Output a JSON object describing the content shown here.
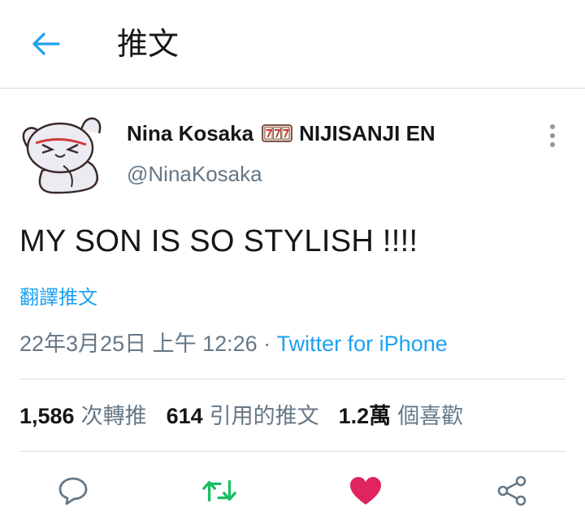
{
  "header": {
    "title": "推文"
  },
  "tweet": {
    "display_name": "Nina Kosaka",
    "display_name_suffix": "NIJISANJI EN",
    "handle": "@NinaKosaka",
    "text": "MY SON IS SO STYLISH !!!!",
    "translate_label": "翻譯推文",
    "timestamp": "22年3月25日 上午 12:26",
    "separator": " · ",
    "source": "Twitter for iPhone"
  },
  "stats": [
    {
      "count": "1,586",
      "label": "次轉推"
    },
    {
      "count": "614",
      "label": "引用的推文"
    },
    {
      "count": "1.2萬",
      "label": "個喜歡"
    }
  ],
  "colors": {
    "accent": "#1da1f2",
    "retweet": "#17bf63",
    "like": "#e0245e",
    "secondary_text": "#657786"
  },
  "icons": {
    "back": "arrow-left-icon",
    "more": "more-vertical-icon",
    "reply": "reply-icon",
    "retweet": "retweet-icon",
    "like": "heart-icon",
    "share": "share-icon"
  }
}
